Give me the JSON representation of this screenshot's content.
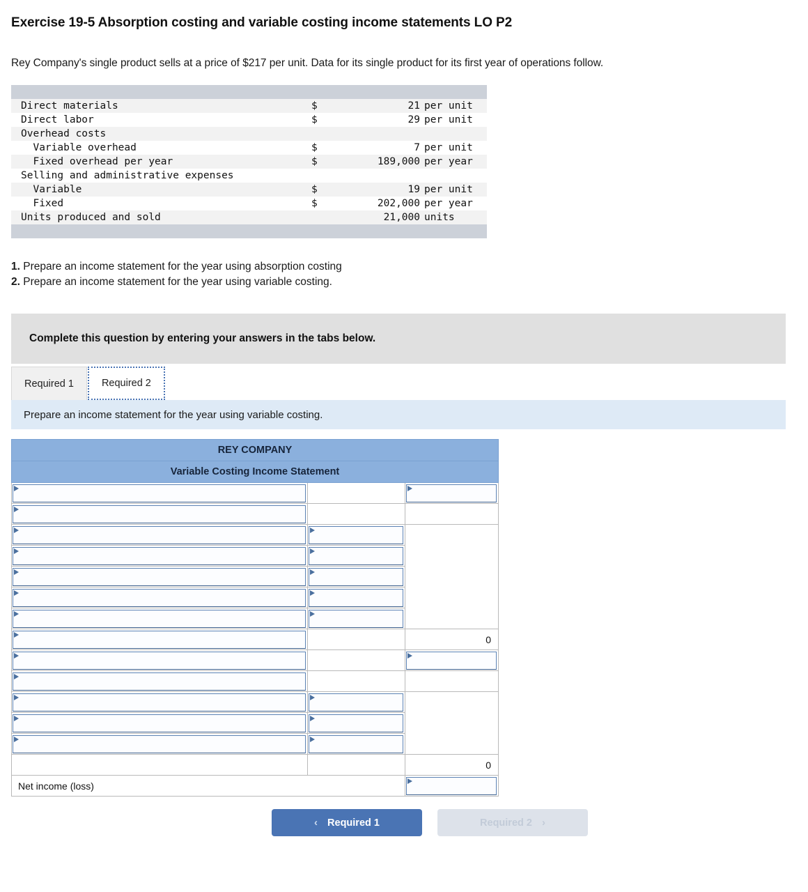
{
  "exercise": {
    "title": "Exercise 19-5 Absorption costing and variable costing income statements LO P2",
    "intro": "Rey Company's single product sells at a price of $217 per unit. Data for its single product for its first year of operations follow."
  },
  "fact_table": {
    "rows": [
      {
        "label": "Direct materials",
        "currency": "$",
        "amount": "21",
        "unit": "per unit"
      },
      {
        "label": "Direct labor",
        "currency": "$",
        "amount": "29",
        "unit": "per unit"
      },
      {
        "label": "Overhead costs",
        "currency": "",
        "amount": "",
        "unit": ""
      },
      {
        "label": "  Variable overhead",
        "currency": "$",
        "amount": "7",
        "unit": "per unit"
      },
      {
        "label": "  Fixed overhead per year",
        "currency": "$",
        "amount": "189,000",
        "unit": "per year"
      },
      {
        "label": "Selling and administrative expenses",
        "currency": "",
        "amount": "",
        "unit": ""
      },
      {
        "label": "  Variable",
        "currency": "$",
        "amount": "19",
        "unit": "per unit"
      },
      {
        "label": "  Fixed",
        "currency": "$",
        "amount": "202,000",
        "unit": "per year"
      },
      {
        "label": "Units produced and sold",
        "currency": "",
        "amount": "21,000",
        "unit": "units"
      }
    ]
  },
  "requirements": {
    "items": [
      {
        "num": "1.",
        "text": " Prepare an income statement for the year using absorption costing"
      },
      {
        "num": "2.",
        "text": " Prepare an income statement for the year using variable costing."
      }
    ]
  },
  "complete_banner": {
    "text": "Complete this question by entering your answers in the tabs below."
  },
  "tabs": [
    {
      "label": "Required 1",
      "active": false
    },
    {
      "label": "Required 2",
      "active": true
    }
  ],
  "instruction": {
    "text": "Prepare an income statement for the year using variable costing."
  },
  "statement": {
    "company": "REY COMPANY",
    "subtitle": "Variable Costing Income Statement",
    "net_income_label": "Net income (loss)",
    "total_a": "0",
    "total_b": "0"
  },
  "nav": {
    "prev_label": "Required 1",
    "next_label": "Required 2",
    "prev_chevron": "‹",
    "next_chevron": "›"
  },
  "colors": {
    "header_blue": "#8bb0dd",
    "button_blue": "#4a74b4",
    "instruction_blue": "#deeaf6",
    "banner_gray": "#e0e0e0",
    "input_border": "#5b82b4"
  }
}
